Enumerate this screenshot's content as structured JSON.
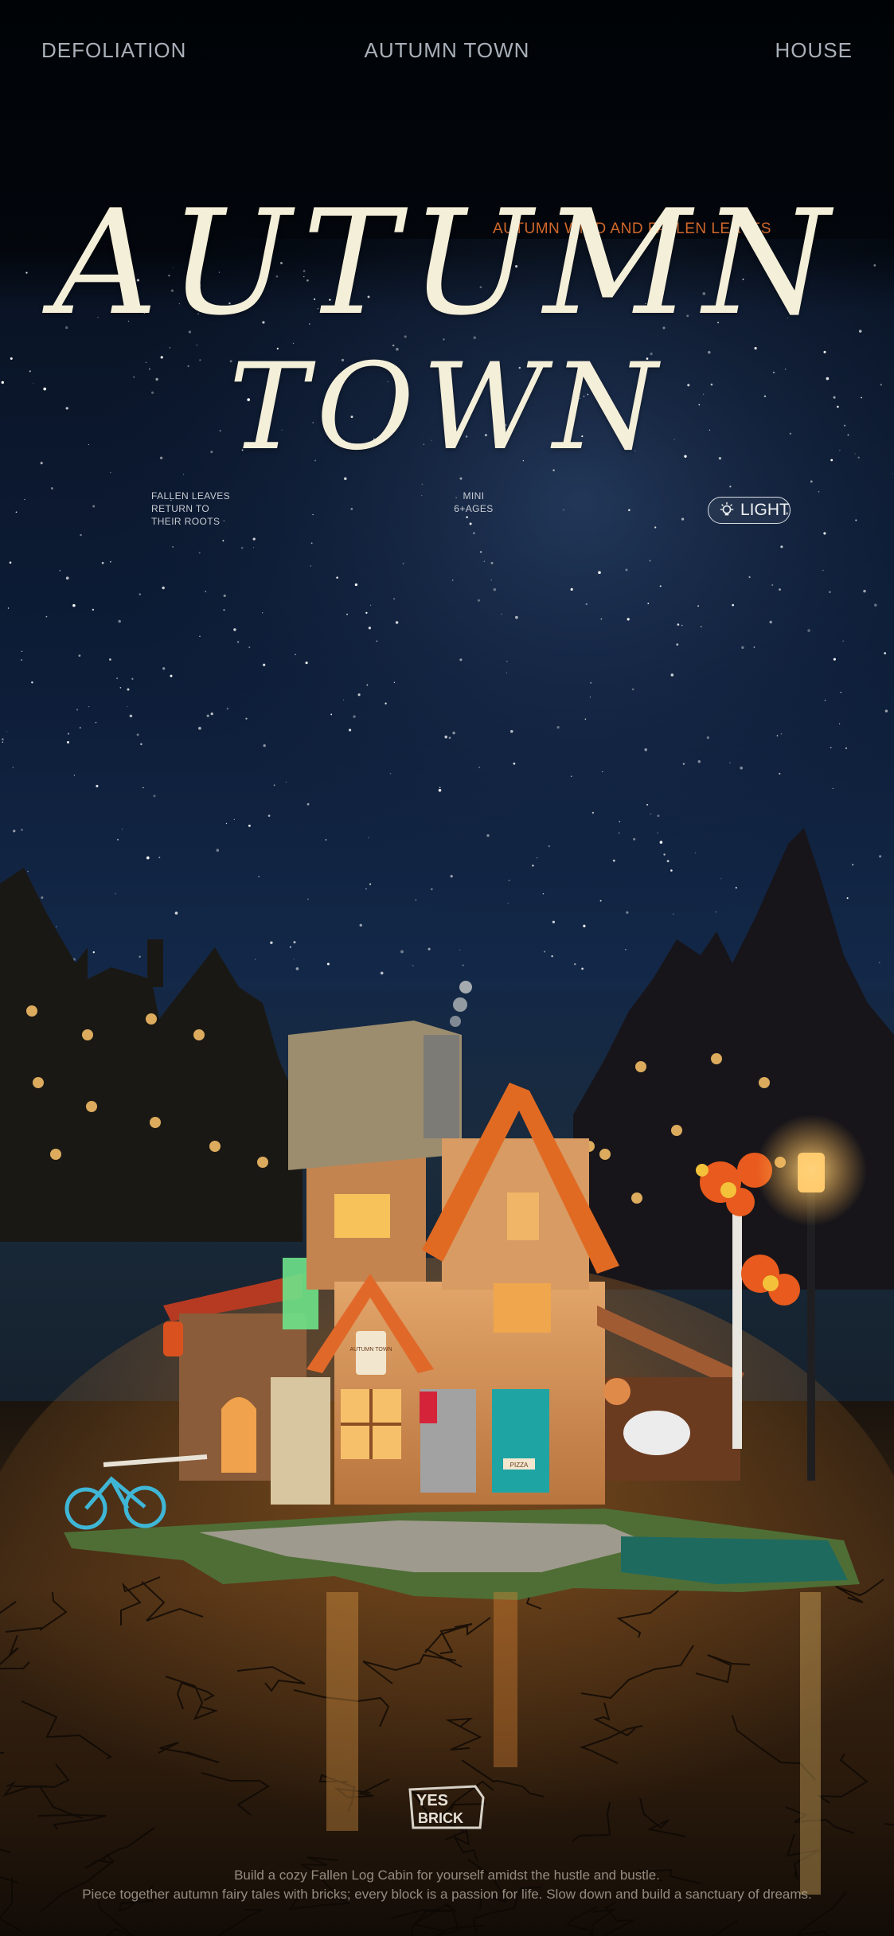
{
  "nav": {
    "left": "DEFOLIATION",
    "center": "AUTUMN  TOWN",
    "right": "HOUSE"
  },
  "tagline": "AUTUMN WIND AND FALLEN LEAVES",
  "title": {
    "line1": "AUTUMN",
    "line2": "TOWN"
  },
  "info_left": [
    "FALLEN LEAVES",
    "RETURN TO",
    "THEIR ROOTS"
  ],
  "info_center": [
    "MINI",
    "6+AGES"
  ],
  "light_badge": {
    "label": "LIGHT",
    "icon": "lightbulb-icon"
  },
  "house_signs": {
    "sign": "AUTUMN TOWN",
    "plaque": "PIZZA"
  },
  "brand": {
    "line1": "YES",
    "line2": "BRICK"
  },
  "caption": {
    "line1": "Build a cozy Fallen Log Cabin for yourself amidst the hustle and bustle.",
    "line2": "Piece together autumn fairy tales with bricks; every block is a passion for life. Slow down and build a sanctuary of dreams."
  },
  "colors": {
    "sky_top": "#000306",
    "sky_mid": "#0b1a33",
    "title_cream": "#f4efd9",
    "tagline_orange": "#d2672a",
    "window_glow": "#f7c25a",
    "roof_orange": "#e16a23",
    "door_teal": "#1fa4a4"
  }
}
